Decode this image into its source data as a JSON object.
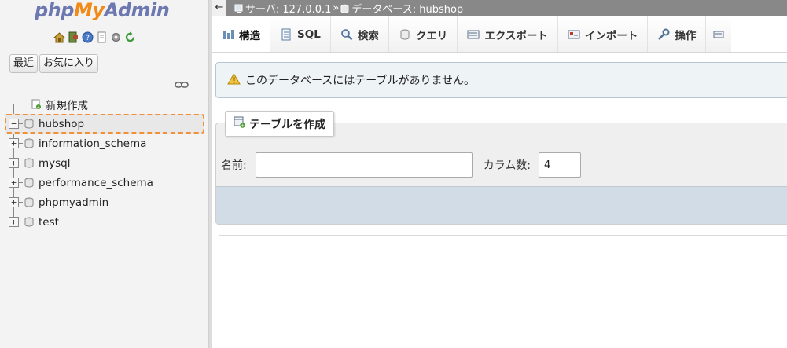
{
  "app": {
    "logo_php": "php",
    "logo_my": "My",
    "logo_admin": "Admin"
  },
  "quick_icons": [
    "home-icon",
    "exit-icon",
    "help-icon",
    "docs-icon",
    "settings-icon",
    "reload-icon"
  ],
  "nav_tabs": [
    {
      "label": "最近"
    },
    {
      "label": "お気に入り"
    }
  ],
  "tree": {
    "new_label": "新規作成",
    "databases": [
      {
        "name": "hubshop",
        "expanded": true,
        "selected": true
      },
      {
        "name": "information_schema",
        "expanded": false
      },
      {
        "name": "mysql",
        "expanded": false
      },
      {
        "name": "performance_schema",
        "expanded": false
      },
      {
        "name": "phpmyadmin",
        "expanded": false
      },
      {
        "name": "test",
        "expanded": false
      }
    ]
  },
  "breadcrumb": {
    "back": "←",
    "server": "サーバ: 127.0.0.1",
    "separator": "»",
    "database": "データベース: hubshop"
  },
  "menu_tabs": [
    {
      "label": "構造",
      "icon": "structure-icon",
      "active": true
    },
    {
      "label": "SQL",
      "icon": "sql-icon"
    },
    {
      "label": "検索",
      "icon": "search-icon"
    },
    {
      "label": "クエリ",
      "icon": "query-icon"
    },
    {
      "label": "エクスポート",
      "icon": "export-icon"
    },
    {
      "label": "インポート",
      "icon": "import-icon"
    },
    {
      "label": "操作",
      "icon": "operations-icon"
    }
  ],
  "notice": {
    "text": "このデータベースにはテーブルがありません。"
  },
  "create_table": {
    "legend": "テーブルを作成",
    "name_label": "名前:",
    "name_value": "",
    "columns_label": "カラム数:",
    "columns_value": "4"
  },
  "colors": {
    "accent_orange": "#f0913a",
    "breadcrumb_bg": "#888888",
    "notice_bg": "#eef3f6",
    "footer_bar": "#d2dce7"
  }
}
